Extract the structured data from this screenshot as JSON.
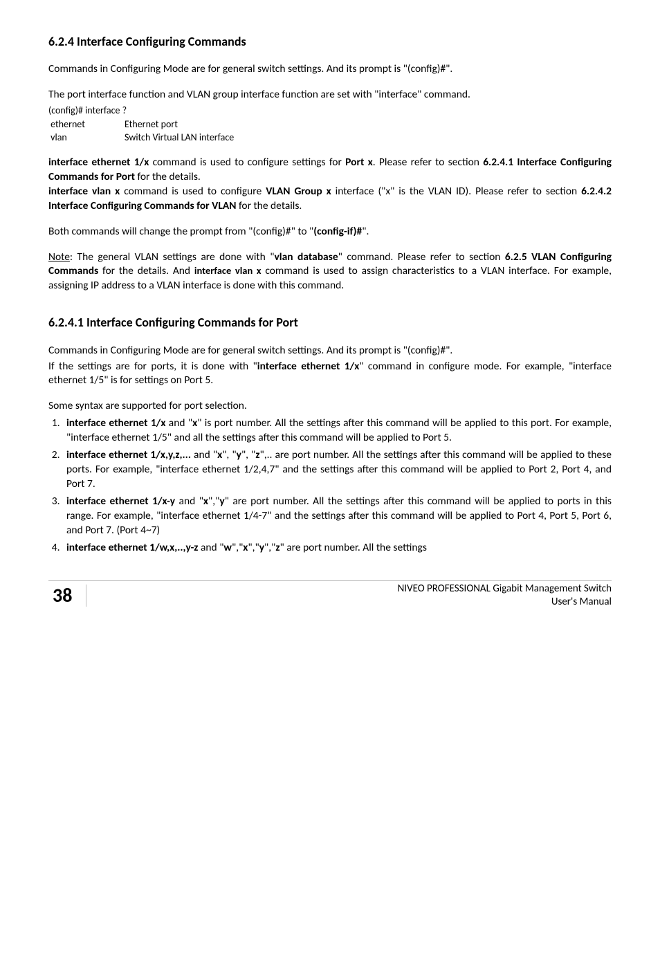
{
  "section1": {
    "heading": "6.2.4 Interface Configuring Commands",
    "para1": "Commands in Configuring Mode are for general switch settings.  And its prompt is \"(config)#\".",
    "para2": "The port interface function and VLAN group interface function are set with \"interface\" command.",
    "code": {
      "line1": "(config)# interface ?",
      "line2_left": " ethernet",
      "line2_right": "Ethernet port",
      "line3_left": " vlan",
      "line3_right": "Switch Virtual LAN interface"
    },
    "para3_pre": "interface ethernet 1/x",
    "para3_mid": " command is used to configure settings for ",
    "para3_port": "Port x",
    "para3_post": ". Please refer to section ",
    "para3_ref": "6.2.4.1 Interface Configuring Commands for Port",
    "para3_end": " for the details.",
    "para4_pre": "interface vlan x",
    "para4_mid": " command is used to configure ",
    "para4_vlan": "VLAN Group x",
    "para4_post": " interface (\"x\" is the VLAN ID).  Please refer to section ",
    "para4_ref": "6.2.4.2 Interface Configuring Commands for VLAN",
    "para4_end": " for the details.",
    "para5_a": "Both commands will change the prompt from \"(config)#\" to \"",
    "para5_b": "(config-if)#",
    "para5_c": "\".",
    "note_label": "Note",
    "note_a": ": The general VLAN settings are done with \"",
    "note_b": "vlan database",
    "note_c": "\" command.  Please refer to section ",
    "note_d": "6.2.5 VLAN Configuring Commands",
    "note_e": " for the details.  And ",
    "note_f": "interface vlan x",
    "note_g": " command is used to assign characteristics to a VLAN interface.  For example, assigning IP address to a VLAN interface is done with this command."
  },
  "section2": {
    "heading": "6.2.4.1 Interface Configuring Commands for Port",
    "para1": "Commands in Configuring Mode are for general switch settings.  And its prompt is \"(config)#\".",
    "para2_a": "If the settings are for ports, it is done with \"",
    "para2_b": "interface ethernet 1/x",
    "para2_c": "\" command in configure mode.  For example, \"interface ethernet 1/5\" is for settings on Port 5.",
    "syntax_intro": "Some syntax are supported for port selection.",
    "item1_cmd": "interface ethernet 1/x",
    "item1_and": " and \"",
    "item1_x": "x",
    "item1_rest": "\" is port number. All the settings after this command will be applied to this port.  For example, \"interface ethernet 1/5\" and all the settings after this command will be applied to Port 5.",
    "item2_cmd": "interface ethernet 1/x,y,z,...",
    "item2_and": " and \"",
    "item2_x": "x",
    "item2_y": "y",
    "item2_z": "z",
    "item2_sep1": "\", \"",
    "item2_sep2": "\", \"",
    "item2_rest": "\",.. are port number.  All the settings after this command will be applied to these ports.  For example, \"interface ethernet 1/2,4,7\" and the settings after this command will be applied to Port 2, Port 4, and Port 7.",
    "item3_cmd": "interface ethernet 1/x-y",
    "item3_and": " and \"",
    "item3_x": "x",
    "item3_y": "y",
    "item3_sep": "\",\"",
    "item3_rest": "\" are port number.  All the settings after this command will be applied to ports in this range.  For example, \"interface ethernet 1/4-7\" and the settings after this command will be applied to Port 4, Port 5, Port 6, and Port 7. (Port 4~7)",
    "item4_cmd": "interface ethernet 1/w,x,..,y-z",
    "item4_and": " and \"",
    "item4_w": "w",
    "item4_x": "x",
    "item4_y": "y",
    "item4_z": "z",
    "item4_sep": "\",\"",
    "item4_rest": "\" are port number.  All the settings"
  },
  "footer": {
    "page": "38",
    "title": "NIVEO PROFESSIONAL Gigabit Management Switch",
    "subtitle": "User's Manual"
  }
}
